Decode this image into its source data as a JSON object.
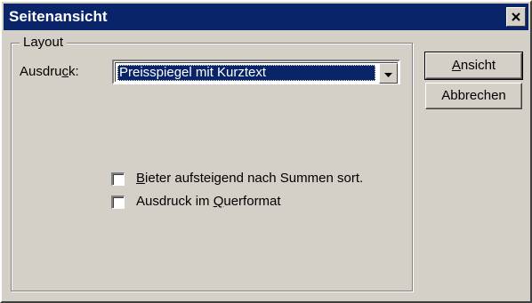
{
  "window": {
    "title": "Seitenansicht",
    "close_icon": "close-icon"
  },
  "layout_group": {
    "legend": "Layout",
    "ausdruck_label_prefix": "Ausdru",
    "ausdruck_label_mnemonic": "c",
    "ausdruck_label_suffix": "k:",
    "ausdruck_value": "Preisspiegel mit Kurztext",
    "dropdown_icon": "chevron-down-icon",
    "checkboxes": [
      {
        "mnemonic": "B",
        "label_rest": "ieter aufsteigend nach Summen sort.",
        "checked": false
      },
      {
        "label_prefix": "Ausdruck im ",
        "mnemonic": "Q",
        "label_rest": "uerformat",
        "checked": false
      }
    ]
  },
  "buttons": {
    "ansicht_mnemonic": "A",
    "ansicht_rest": "nsicht",
    "abbrechen": "Abbrechen"
  },
  "colors": {
    "titlebar": "#0a246a",
    "face": "#d4d0c8",
    "selection": "#0a246a"
  }
}
